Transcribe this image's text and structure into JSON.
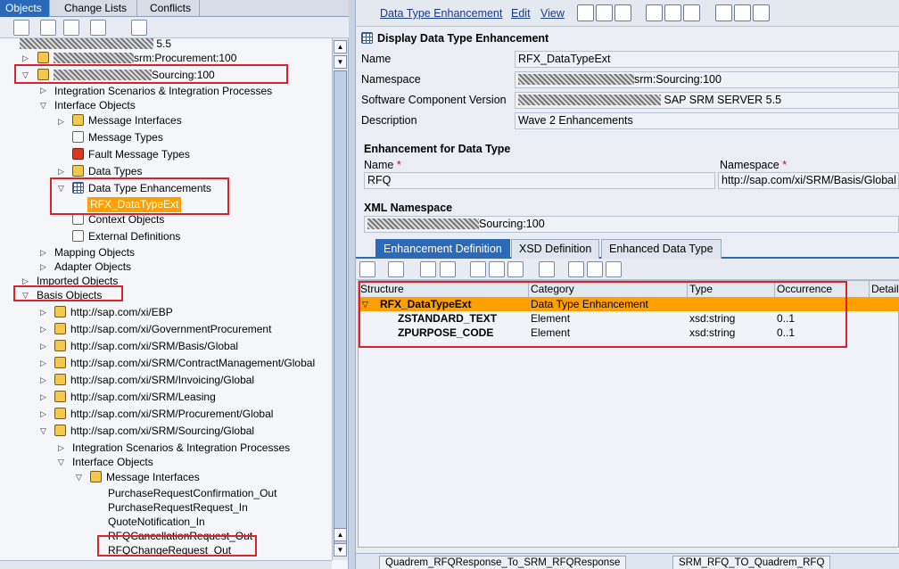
{
  "left_panel": {
    "tabs": [
      "Objects",
      "Change Lists",
      "Conflicts"
    ],
    "tree": [
      {
        "label": "5.5",
        "redacted": true
      },
      {
        "label": "srm:Procurement:100",
        "redacted": true
      },
      {
        "label": "Sourcing:100",
        "redacted": true
      },
      {
        "label": "Integration Scenarios & Integration Processes"
      },
      {
        "label": "Interface Objects"
      },
      {
        "label": "Message Interfaces"
      },
      {
        "label": "Message Types"
      },
      {
        "label": "Fault Message Types"
      },
      {
        "label": "Data Types"
      },
      {
        "label": "Data Type Enhancements"
      },
      {
        "label": "RFX_DataTypeExt"
      },
      {
        "label": "Context Objects"
      },
      {
        "label": "External Definitions"
      },
      {
        "label": "Mapping Objects"
      },
      {
        "label": "Adapter Objects"
      },
      {
        "label": "Imported Objects"
      },
      {
        "label": "Basis Objects"
      },
      {
        "label": "http://sap.com/xi/EBP"
      },
      {
        "label": "http://sap.com/xi/GovernmentProcurement"
      },
      {
        "label": "http://sap.com/xi/SRM/Basis/Global"
      },
      {
        "label": "http://sap.com/xi/SRM/ContractManagement/Global"
      },
      {
        "label": "http://sap.com/xi/SRM/Invoicing/Global"
      },
      {
        "label": "http://sap.com/xi/SRM/Leasing"
      },
      {
        "label": "http://sap.com/xi/SRM/Procurement/Global"
      },
      {
        "label": "http://sap.com/xi/SRM/Sourcing/Global"
      },
      {
        "label": "Integration Scenarios & Integration Processes"
      },
      {
        "label": "Interface Objects"
      },
      {
        "label": "Message Interfaces"
      },
      {
        "label": "PurchaseRequestConfirmation_Out"
      },
      {
        "label": "PurchaseRequestRequest_In"
      },
      {
        "label": "QuoteNotification_In"
      },
      {
        "label": "RFQCancellationRequest_Out"
      },
      {
        "label": "RFQChangeRequest_Out"
      }
    ]
  },
  "menu": {
    "items": [
      "Data Type Enhancement",
      "Edit",
      "View"
    ]
  },
  "header": {
    "title": "Display Data Type Enhancement",
    "name_label": "Name",
    "name_value": "RFX_DataTypeExt",
    "namespace_label": "Namespace",
    "namespace_value": "srm:Sourcing:100",
    "swcv_label": "Software Component Version",
    "swcv_value": "SAP SRM SERVER 5.5",
    "desc_label": "Description",
    "desc_value": "Wave 2 Enhancements"
  },
  "enhancement": {
    "title": "Enhancement for Data Type",
    "name_label": "Name",
    "name_value": "RFQ",
    "namespace_label": "Namespace",
    "namespace_value": "http://sap.com/xi/SRM/Basis/Global",
    "required_mark": "*"
  },
  "xml_namespace": {
    "title": "XML Namespace",
    "value": "Sourcing:100"
  },
  "tabs": [
    "Enhancement Definition",
    "XSD Definition",
    "Enhanced Data Type"
  ],
  "table": {
    "columns": [
      "Structure",
      "Category",
      "Type",
      "Occurrence",
      "Detail"
    ],
    "rows": [
      {
        "structure": "RFX_DataTypeExt",
        "category": "Data Type Enhancement",
        "type": "",
        "occurrence": ""
      },
      {
        "structure": "ZSTANDARD_TEXT",
        "category": "Element",
        "type": "xsd:string",
        "occurrence": "0..1"
      },
      {
        "structure": "ZPURPOSE_CODE",
        "category": "Element",
        "type": "xsd:string",
        "occurrence": "0..1"
      }
    ]
  },
  "bottom_tabs": [
    "Quadrem_RFQResponse_To_SRM_RFQResponse",
    "SRM_RFQ_TO_Quadrem_RFQ"
  ],
  "colors": {
    "accent": "#2a6ab8",
    "selection": "#ffa000",
    "highlight_box": "#e0202a"
  }
}
